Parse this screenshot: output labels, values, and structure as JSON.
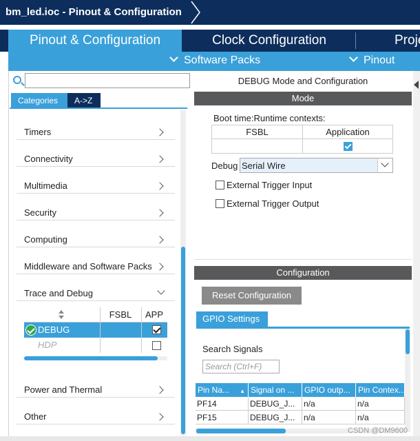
{
  "window": {
    "title": "bm_led.ioc - Pinout & Configuration"
  },
  "main_tabs": [
    {
      "label": "Pinout & Configuration"
    },
    {
      "label": "Clock Configuration"
    },
    {
      "label": "Proje"
    }
  ],
  "subbar": {
    "software_packs": "Software Packs",
    "pinout": "Pinout"
  },
  "left": {
    "search_placeholder": "",
    "cat_tab_1": "Categories",
    "cat_tab_2": "A->Z",
    "categories": [
      {
        "label": "Timers"
      },
      {
        "label": "Connectivity"
      },
      {
        "label": "Multimedia"
      },
      {
        "label": "Security"
      },
      {
        "label": "Computing"
      },
      {
        "label": "Middleware and Software Packs"
      },
      {
        "label": "Trace and Debug"
      },
      {
        "label": "Power and Thermal"
      },
      {
        "label": "Other"
      }
    ],
    "trace_table": {
      "col_fsbl": "FSBL",
      "col_app": "APP",
      "rows": [
        {
          "name": "DEBUG",
          "app_checked": true,
          "fsbl_checked": false
        },
        {
          "name": "HDP",
          "app_checked": false,
          "fsbl_checked": false
        }
      ]
    }
  },
  "right": {
    "panel_title": "DEBUG Mode and Configuration",
    "mode_header": "Mode",
    "boot_label": "Boot time:Runtime contexts:",
    "boot_col_fsbl": "FSBL",
    "boot_col_app": "Application",
    "boot_app_checked": true,
    "debug_label": "Debug",
    "debug_value": "Serial Wire",
    "opt_ext_input": "External Trigger Input",
    "opt_ext_output": "External Trigger Output",
    "config_header": "Configuration",
    "reset_button": "Reset Configuration",
    "gpio_tab": "GPIO Settings",
    "search_signals_label": "Search Signals",
    "search_placeholder": "Search (Ctrl+F)",
    "sig_table": {
      "headers": [
        "Pin Na...",
        "Signal on ...",
        "GPIO outp...",
        "Pin Contex..."
      ],
      "rows": [
        [
          "PF14",
          "DEBUG_J...",
          "n/a",
          "n/a"
        ],
        [
          "PF15",
          "DEBUG_J...",
          "n/a",
          "n/a"
        ]
      ]
    }
  },
  "watermark": "CSDN @DM9600",
  "colors": {
    "navy": "#0d2e5c",
    "accent": "#3aa0da",
    "section_header": "#58595b"
  }
}
